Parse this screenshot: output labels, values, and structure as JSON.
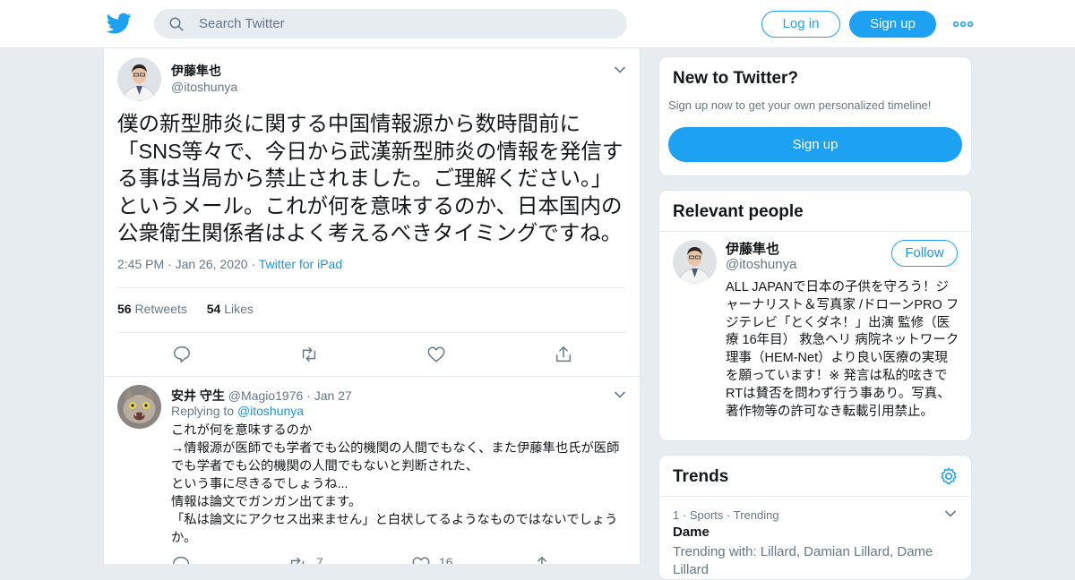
{
  "header": {
    "search_placeholder": "Search Twitter",
    "login_label": "Log in",
    "signup_label": "Sign up",
    "logo_icon": "twitter-bird-icon",
    "more_icon": "more-dots-icon",
    "brand_color": "#1da1f2"
  },
  "tweet": {
    "author_name": "伊藤隼也",
    "author_handle": "@itoshunya",
    "text": "僕の新型肺炎に関する中国情報源から数時間前に「SNS等々で、今日から武漢新型肺炎の情報を発信する事は当局から禁止されました。ご理解ください。」というメール。これが何を意味するのか、日本国内の公衆衛生関係者はよく考えるべきタイミングですね。",
    "time": "2:45 PM",
    "date": "Jan 26, 2020",
    "source": "Twitter for iPad",
    "retweets_count": "56",
    "retweets_label": "Retweets",
    "likes_count": "54",
    "likes_label": "Likes"
  },
  "reply": {
    "author_name": "安井 守生",
    "author_handle": "@Magio1976",
    "date": "Jan 27",
    "replying_prefix": "Replying to",
    "replying_to": "@itoshunya",
    "lines": [
      "これが何を意味するのか",
      "→情報源が医師でも学者でも公的機関の人間でもなく、また伊藤隼也氏が医師でも学者でも公的機関の人間でもないと判断された、",
      "という事に尽きるでしょうね...",
      "情報は論文でガンガン出てます。",
      "「私は論文にアクセス出来ません」と白状してるようなものではないでしょうか。"
    ],
    "retweets_count": "7",
    "likes_count": "16"
  },
  "sidebar": {
    "new_to_twitter": {
      "title": "New to Twitter?",
      "subtitle": "Sign up now to get your own personalized timeline!",
      "signup_label": "Sign up"
    },
    "relevant_people": {
      "title": "Relevant people",
      "name": "伊藤隼也",
      "handle": "@itoshunya",
      "follow_label": "Follow",
      "bio": "ALL JAPANで日本の子供を守ろう！ジャーナリスト＆写真家 /ドローンPRO フジテレビ「とくダネ！」出演 監修（医療 16年目） 救急ヘリ 病院ネットワーク理事（HEM-Net）より良い医療の実現を願っています！※ 発言は私的呟きでRTは賛否を問わず行う事あり。写真、著作物等の許可なき転載引用禁止。"
    },
    "trends": {
      "title": "Trends",
      "items": [
        {
          "rank": "1",
          "category": "Sports",
          "status": "Trending",
          "name": "Dame",
          "with_text": "Trending with: Lillard, Damian Lillard, Dame Lillard"
        }
      ]
    }
  }
}
